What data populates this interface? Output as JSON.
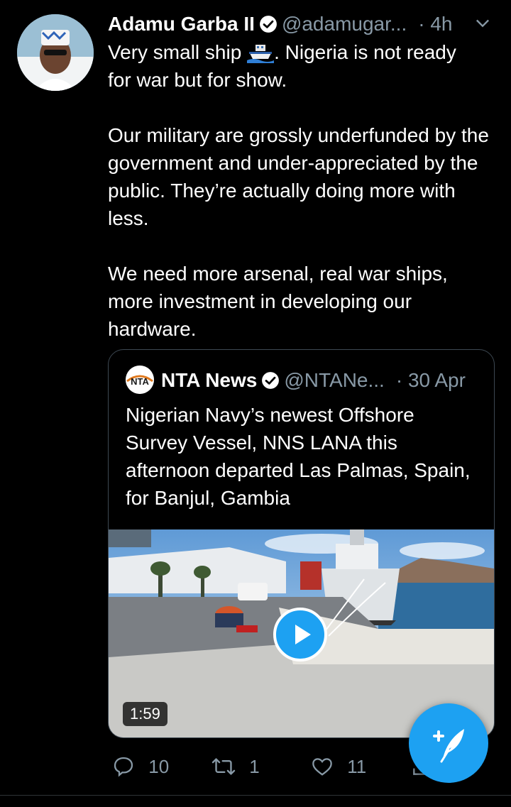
{
  "tweet": {
    "author_name": "Adamu Garba II",
    "author_handle": "@adamugar...",
    "time": "· 4h",
    "text_line1_a": "Very small ship",
    "text_line1_b": ". Nigeria is not ready",
    "text_line2": "for war but for show.",
    "text_para2": "Our military are grossly underfunded by the government and under-appreciated by the public.  They’re actually doing more with less.",
    "text_para3": "We need more arsenal, real war ships, more investment in developing our hardware.",
    "icons": {
      "verified": "verified-badge-icon",
      "more": "chevron-down-icon",
      "ship_emoji": "ship-emoji-icon"
    }
  },
  "quote": {
    "author_name": "NTA News",
    "author_handle": "@NTANe...",
    "time": "· 30 Apr",
    "text": "Nigerian Navy’s newest Offshore Survey Vessel, NNS LANA this afternoon departed Las Palmas, Spain, for Banjul, Gambia",
    "logo_text": "NTA",
    "video_duration": "1:59"
  },
  "actions": {
    "reply_count": "10",
    "retweet_count": "1",
    "like_count": "11"
  },
  "colors": {
    "background": "#000000",
    "accent": "#1da1f2",
    "secondary_text": "#8899a6",
    "border": "#3d4852"
  }
}
